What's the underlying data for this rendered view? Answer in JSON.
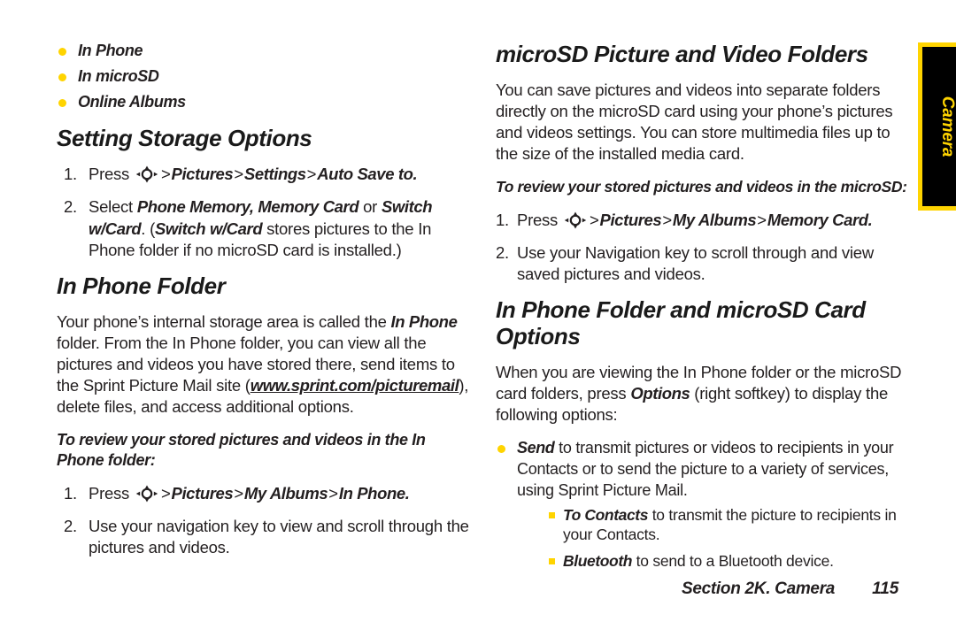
{
  "document": {
    "page_number": "115",
    "section_label": "Section 2K. Camera",
    "side_tab_label": "Camera"
  },
  "left_column": {
    "storage_bullets": [
      "In Phone",
      "In microSD",
      "Online Albums"
    ],
    "heading_setting_storage": "Setting Storage Options",
    "step1_press": "Press",
    "step1_path_pictures": "Pictures",
    "step1_path_settings": "Settings",
    "step1_path_autosave": "Auto Save to",
    "step1_period": ".",
    "step2_select": "Select",
    "step2_opt1": "Phone Memory, Memory Card",
    "step2_or": "or",
    "step2_opt2": "Switch w/Card",
    "step2_period": ".",
    "step2_paren_open": "(",
    "step2_paren_bold": "Switch w/Card",
    "step2_paren_rest": " stores pictures to the In Phone folder if no microSD card is installed.)",
    "heading_in_phone_folder": "In Phone Folder",
    "para_internal_pre": "Your phone’s internal storage area is called the ",
    "para_internal_bold": "In Phone",
    "para_internal_mid": " folder. From the In Phone folder, you can view all the pictures and videos you have stored there, send items to the Sprint Picture Mail site (",
    "para_internal_url": "www.sprint.com/picturemail",
    "para_internal_post": "), delete files, and access additional options.",
    "leadin_review": "To review your stored pictures and videos in the In Phone folder:",
    "review_step1_press": "Press",
    "review_step1_path_pictures": "Pictures",
    "review_step1_path_myalbums": "My Albums",
    "review_step1_path_inphone": "In Phone",
    "review_step1_period": ".",
    "review_step2": "Use your navigation key to view and scroll through the pictures and videos."
  },
  "right_column": {
    "heading_microsd_folders": "microSD Picture and Video Folders",
    "para_save": "You can save pictures and videos into separate folders directly on the microSD card using your phone’s pictures and videos settings. You can store multimedia files up to the size of the installed media card.",
    "leadin_review_microsd": "To review your stored pictures and videos in the microSD:",
    "ms_step1_press": "Press",
    "ms_step1_path_pictures": "Pictures",
    "ms_step1_path_myalbums": "My Albums",
    "ms_step1_path_memorycard": "Memory Card",
    "ms_step1_period": ".",
    "ms_step2": "Use your Navigation key to scroll through and view saved pictures and videos.",
    "heading_options": "In Phone Folder and microSD Card Options",
    "para_when_pre": "When you are viewing the In Phone folder or the microSD card folders, press ",
    "para_when_bold": "Options",
    "para_when_post": " (right softkey) to display the following options:",
    "option_send_bold": "Send",
    "option_send_rest": " to transmit pictures or videos to recipients in your Contacts or to send the picture to a variety of services, using Sprint Picture Mail.",
    "sub_to_contacts_bold": "To Contacts",
    "sub_to_contacts_rest": " to transmit the picture to recipients in your Contacts.",
    "sub_bluetooth_bold": "Bluetooth",
    "sub_bluetooth_rest": " to send to a Bluetooth device."
  },
  "numbers": {
    "one": "1.",
    "two": "2."
  },
  "colors": {
    "accent_yellow": "#FFD400",
    "text": "#231f20",
    "tab_background": "#000000"
  },
  "icons": {
    "navigation_key": "navigation-key-icon",
    "chevron": ">"
  }
}
